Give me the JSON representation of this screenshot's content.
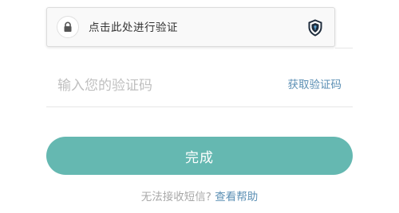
{
  "verify": {
    "label": "点击此处进行验证",
    "lock_icon": "lock-icon",
    "shield_icon": "shield-icon"
  },
  "code": {
    "placeholder": "输入您的验证码",
    "value": "",
    "get_code_label": "获取验证码"
  },
  "submit": {
    "label": "完成"
  },
  "help": {
    "prompt": "无法接收短信?",
    "link_label": "查看帮助"
  },
  "colors": {
    "accent": "#65b8b1",
    "link": "#5b8fb4",
    "placeholder": "#bfbfbf"
  }
}
